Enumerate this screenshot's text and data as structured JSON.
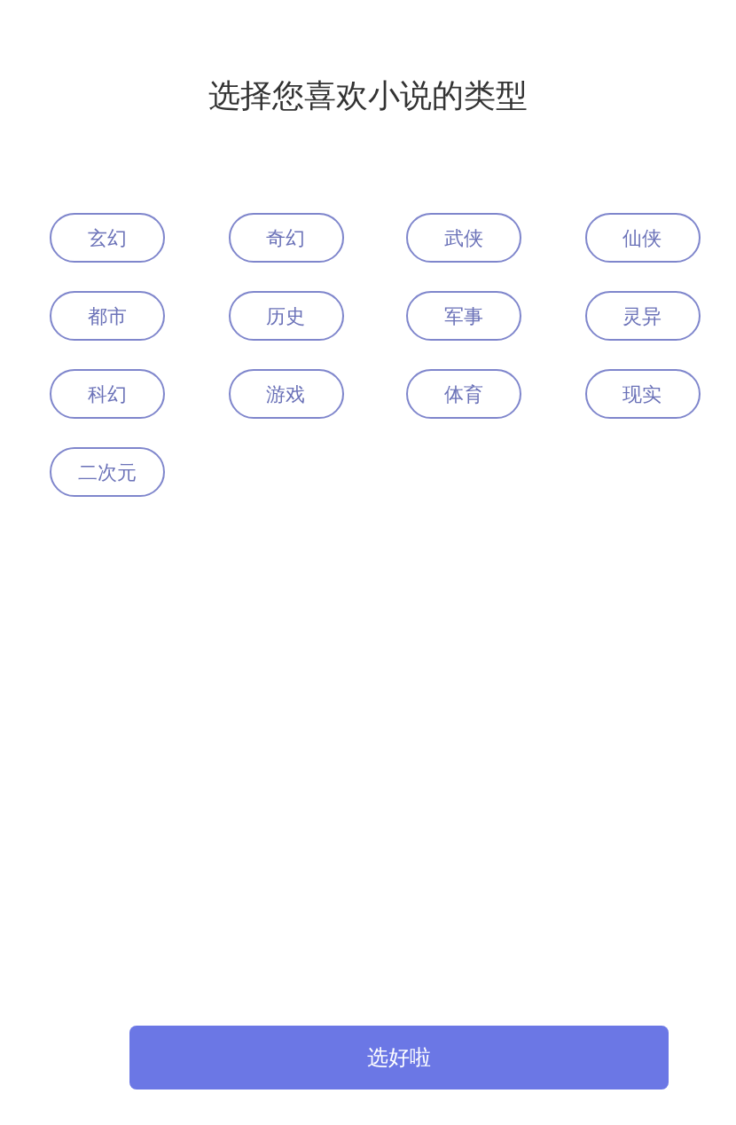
{
  "title": "选择您喜欢小说的类型",
  "genres": [
    {
      "label": "玄幻",
      "selected": false
    },
    {
      "label": "奇幻",
      "selected": false
    },
    {
      "label": "武侠",
      "selected": false
    },
    {
      "label": "仙侠",
      "selected": false
    },
    {
      "label": "都市",
      "selected": false
    },
    {
      "label": "历史",
      "selected": false
    },
    {
      "label": "军事",
      "selected": false
    },
    {
      "label": "灵异",
      "selected": false
    },
    {
      "label": "科幻",
      "selected": false
    },
    {
      "label": "游戏",
      "selected": false
    },
    {
      "label": "体育",
      "selected": false
    },
    {
      "label": "现实",
      "selected": false
    },
    {
      "label": "二次元",
      "selected": false
    }
  ],
  "confirm_button": "选好啦"
}
